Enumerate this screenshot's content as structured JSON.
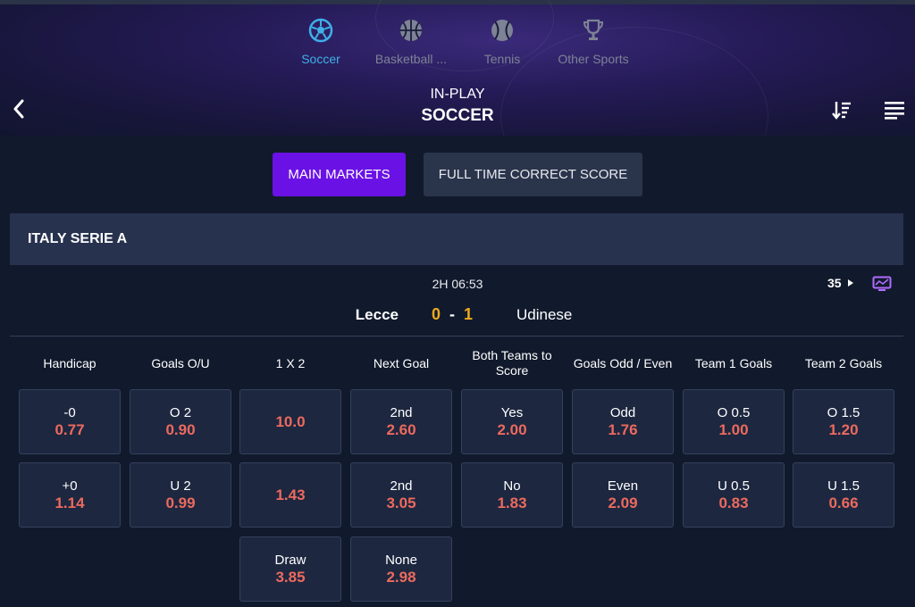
{
  "sports_tabs": [
    {
      "label": "Soccer",
      "icon": "soccer-ball-icon",
      "active": true
    },
    {
      "label": "Basketball ...",
      "icon": "basketball-icon",
      "active": false
    },
    {
      "label": "Tennis",
      "icon": "tennis-ball-icon",
      "active": false
    },
    {
      "label": "Other Sports",
      "icon": "trophy-icon",
      "active": false
    }
  ],
  "header": {
    "subtitle": "IN-PLAY",
    "title": "SOCCER"
  },
  "market_tabs": {
    "main": "MAIN MARKETS",
    "correct_score": "FULL TIME CORRECT SCORE"
  },
  "league": "ITALY SERIE A",
  "match": {
    "period_time": "2H  06:53",
    "more_markets": "35",
    "home": "Lecce",
    "away": "Udinese",
    "home_score": "0",
    "away_score": "1",
    "dash": "-"
  },
  "columns": [
    {
      "header": "Handicap",
      "cells": [
        {
          "label": "-0",
          "odd": "0.77"
        },
        {
          "label": "+0",
          "odd": "1.14"
        }
      ]
    },
    {
      "header": "Goals O/U",
      "cells": [
        {
          "label": "O 2",
          "odd": "0.90"
        },
        {
          "label": "U 2",
          "odd": "0.99"
        }
      ]
    },
    {
      "header": "1 X 2",
      "cells": [
        {
          "label": "",
          "odd": "10.0"
        },
        {
          "label": "",
          "odd": "1.43"
        },
        {
          "label": "Draw",
          "odd": "3.85"
        }
      ]
    },
    {
      "header": "Next Goal",
      "cells": [
        {
          "label": "2nd",
          "odd": "2.60"
        },
        {
          "label": "2nd",
          "odd": "3.05"
        },
        {
          "label": "None",
          "odd": "2.98"
        }
      ]
    },
    {
      "header": "Both Teams to Score",
      "cells": [
        {
          "label": "Yes",
          "odd": "2.00"
        },
        {
          "label": "No",
          "odd": "1.83"
        }
      ]
    },
    {
      "header": "Goals Odd / Even",
      "cells": [
        {
          "label": "Odd",
          "odd": "1.76"
        },
        {
          "label": "Even",
          "odd": "2.09"
        }
      ]
    },
    {
      "header": "Team 1 Goals",
      "cells": [
        {
          "label": "O 0.5",
          "odd": "1.00"
        },
        {
          "label": "U 0.5",
          "odd": "0.83"
        }
      ]
    },
    {
      "header": "Team 2 Goals",
      "cells": [
        {
          "label": "O 1.5",
          "odd": "1.20"
        },
        {
          "label": "U 1.5",
          "odd": "0.66"
        }
      ]
    }
  ],
  "colors": {
    "accent": "#6a12e6",
    "odds": "#ec6a5e",
    "score": "#f0a91e",
    "active_sport": "#3fb0e8"
  }
}
